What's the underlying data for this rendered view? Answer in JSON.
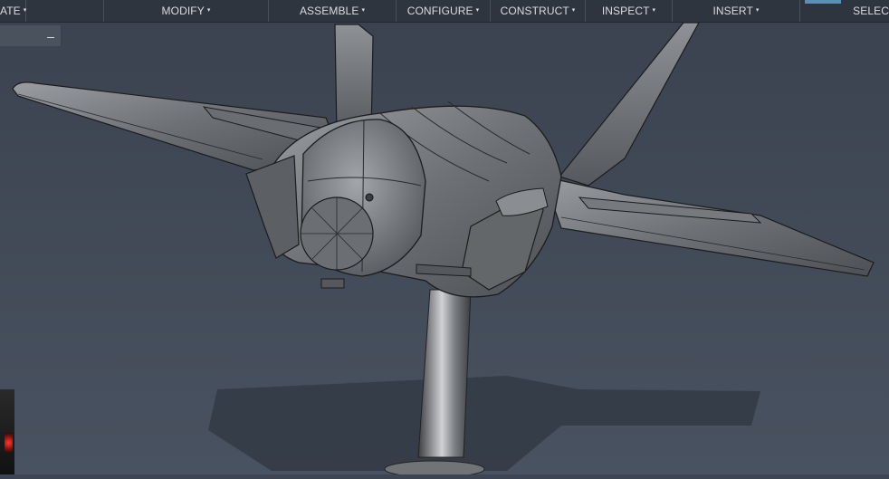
{
  "toolbar": {
    "menus": [
      {
        "label": "ATE",
        "caret": "▾"
      },
      {
        "label": "MODIFY",
        "caret": "▾"
      },
      {
        "label": "ASSEMBLE",
        "caret": "▾"
      },
      {
        "label": "CONFIGURE",
        "caret": "▾"
      },
      {
        "label": "CONSTRUCT",
        "caret": "▾"
      },
      {
        "label": "INSPECT",
        "caret": "▾"
      },
      {
        "label": "INSERT",
        "caret": "▾"
      },
      {
        "label": "SELEC",
        "caret": ""
      }
    ]
  },
  "browser": {
    "collapse_label": "–"
  },
  "colors": {
    "toolbar_bg": "#2e353f",
    "viewport_bg": "#3d4552",
    "model_gray": "#7c7f84"
  }
}
